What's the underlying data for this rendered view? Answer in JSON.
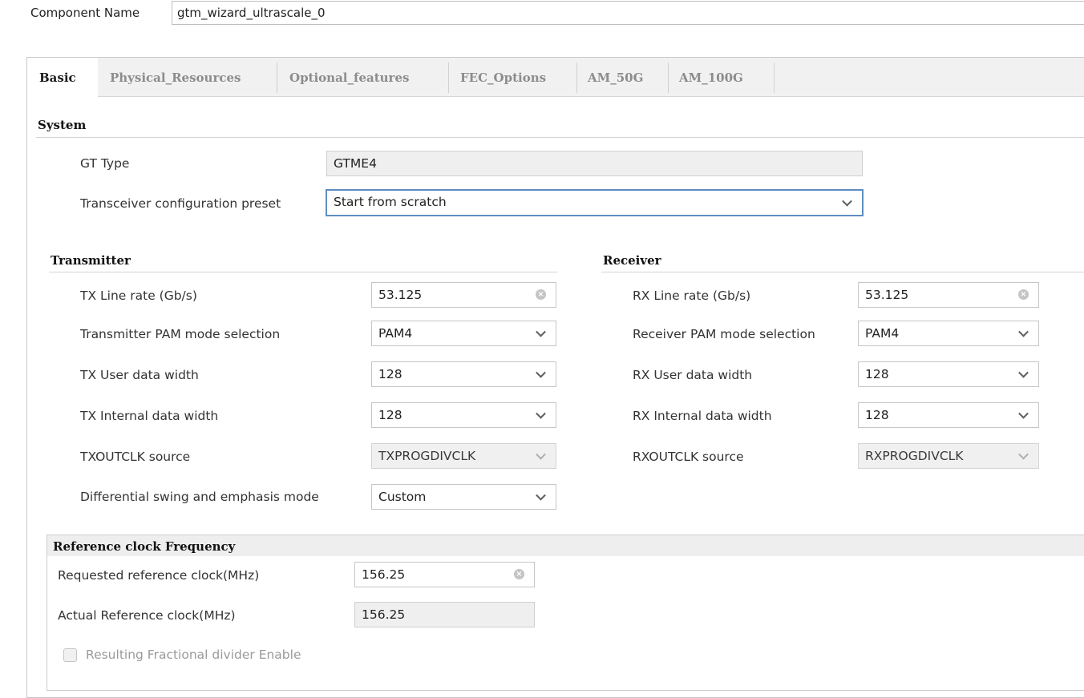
{
  "component": {
    "label": "Component Name",
    "value": "gtm_wizard_ultrascale_0"
  },
  "tabs": [
    {
      "label": "Basic",
      "active": true
    },
    {
      "label": "Physical_Resources",
      "active": false
    },
    {
      "label": "Optional_features",
      "active": false
    },
    {
      "label": "FEC_Options",
      "active": false
    },
    {
      "label": "AM_50G",
      "active": false
    },
    {
      "label": "AM_100G",
      "active": false
    }
  ],
  "system": {
    "title": "System",
    "gt_type": {
      "label": "GT Type",
      "value": "GTME4"
    },
    "preset": {
      "label": "Transceiver configuration preset",
      "value": "Start from scratch"
    }
  },
  "transmitter": {
    "title": "Transmitter",
    "line_rate": {
      "label": "TX Line rate (Gb/s)",
      "value": "53.125"
    },
    "pam_mode": {
      "label": "Transmitter PAM mode selection",
      "value": "PAM4"
    },
    "user_width": {
      "label": "TX User data width",
      "value": "128"
    },
    "internal_width": {
      "label": "TX Internal data width",
      "value": "128"
    },
    "outclk": {
      "label": "TXOUTCLK source",
      "value": "TXPROGDIVCLK"
    },
    "swing": {
      "label": "Differential swing and emphasis mode",
      "value": "Custom"
    }
  },
  "receiver": {
    "title": "Receiver",
    "line_rate": {
      "label": "RX Line rate (Gb/s)",
      "value": "53.125"
    },
    "pam_mode": {
      "label": "Receiver PAM mode selection",
      "value": "PAM4"
    },
    "user_width": {
      "label": "RX User data width",
      "value": "128"
    },
    "internal_width": {
      "label": "RX Internal data width",
      "value": "128"
    },
    "outclk": {
      "label": "RXOUTCLK source",
      "value": "RXPROGDIVCLK"
    }
  },
  "refclk": {
    "title": "Reference clock Frequency",
    "requested": {
      "label": "Requested reference clock(MHz)",
      "value": "156.25"
    },
    "actual": {
      "label": "Actual Reference clock(MHz)",
      "value": "156.25"
    },
    "fractional": {
      "label": "Resulting Fractional divider Enable",
      "checked": false
    }
  },
  "icons": {
    "dropdown": "chevron-down-icon",
    "clear": "clear-icon"
  },
  "colors": {
    "focus_border": "#5e8dc2",
    "tab_bar": "#f1f1f1",
    "readonly_bg": "#efefef"
  }
}
